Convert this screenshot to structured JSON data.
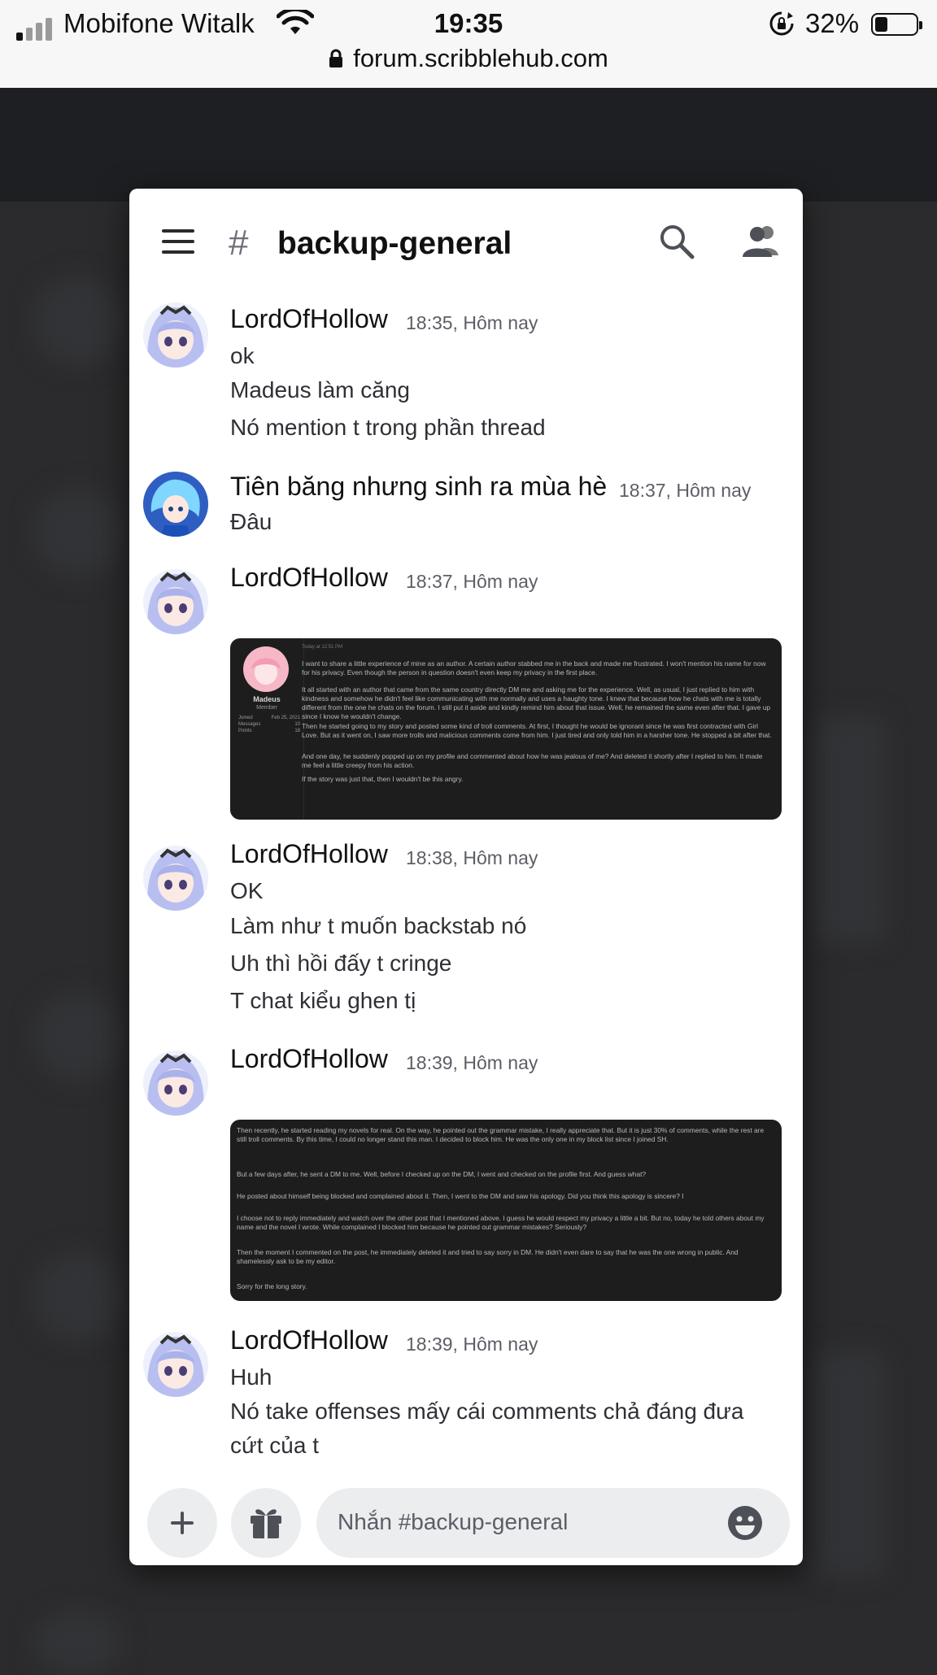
{
  "status_bar": {
    "carrier": "Mobifone Witalk",
    "time": "19:35",
    "battery_percent": "32%",
    "battery_level": 0.32,
    "url": "forum.scribblehub.com"
  },
  "channel": {
    "hash": "#",
    "name": "backup-general"
  },
  "messages": [
    {
      "author": "LordOfHollow",
      "timestamp": "18:35, Hôm nay",
      "lines": [
        "ok",
        "Madeus làm căng",
        "Nó mention t trong phần thread"
      ]
    },
    {
      "author": "Tiên băng nhưng sinh ra mùa hè",
      "timestamp": "18:37, Hôm nay",
      "lines": [
        "Đâu"
      ]
    },
    {
      "author": "LordOfHollow",
      "timestamp": "18:37, Hôm nay",
      "attachment": {
        "header": "Today at 12:51 PM",
        "profile_name": "Madeus",
        "profile_role": "Member",
        "profile_stats": [
          {
            "label": "Joined",
            "value": "Feb 25, 2021"
          },
          {
            "label": "Messages",
            "value": "10"
          },
          {
            "label": "Points",
            "value": "18"
          }
        ],
        "paragraphs": [
          "I want to share a little experience of mine as an author. A certain author stabbed me in the back and made me frustrated. I won't mention his name for now for his privacy. Even though the person in question doesn't even keep my privacy in the first place.",
          "It all started with an author that came from the same country directly DM me and asking me for the experience. Well, as usual, I just replied to him with kindness and somehow he didn't feel like communicating with me normally and uses a haughty tone. I knew that because how he chats with me is totally different from the one he chats on the forum. I still put it aside and kindly remind him about that issue. Well, he remained the same even after that. I gave up since I know he wouldn't change.",
          "Then he started going to my story and posted some kind of troll comments. At first, I thought he would be ignorant since he was first contracted with Girl Love. But as it went on, I saw more trolls and malicious comments come from him. I just tired and only told him in a harsher tone. He stopped a bit after that.",
          "And one day, he suddenly popped up on my profile and commented about how he was jealous of me? And deleted it shortly after I replied to him. It made me feel a little creepy from his action.",
          "If the story was just that, then I wouldn't be this angry."
        ]
      }
    },
    {
      "author": "LordOfHollow",
      "timestamp": "18:38, Hôm nay",
      "lines": [
        "OK",
        "Làm như t muốn backstab nó",
        "Uh thì hồi đấy t cringe",
        "T chat kiểu ghen tị"
      ]
    },
    {
      "author": "LordOfHollow",
      "timestamp": "18:39, Hôm nay",
      "attachment": {
        "paragraphs": [
          "Then recently, he started reading my novels for real. On the way, he pointed out the grammar mistake, I really appreciate that. But it is just 30% of comments, while the rest are still troll comments. By this time, I could no longer stand this man. I decided to block him. He was the only one in my block list since I joined SH.",
          "But a few days after, he sent a DM to me. Well, before I checked up on the DM, I went and checked on the profile first. And guess what?",
          "He posted about himself being blocked and complained about it. Then, I went to the DM and saw his apology. Did you think this apology is sincere? I",
          "I choose not to reply immediately and watch over the other post that I mentioned above. I guess he would respect my privacy a little a bit. But no, today he told others about my name and the novel I wrote. While complained I blocked him because he pointed out grammar mistakes? Seriously?",
          "Then the moment I commented on the post, he immediately deleted it and tried to say sorry in DM. He didn't even dare to say that he was the one wrong in public. And shamelessly ask to be my editor.",
          "Sorry for the long story."
        ]
      }
    },
    {
      "author": "LordOfHollow",
      "timestamp": "18:39, Hôm nay",
      "lines": [
        "Huh",
        "Nó take offenses mấy cái comments chả đáng đưa",
        "cứt của t"
      ]
    }
  ],
  "composer": {
    "placeholder": "Nhắn #backup-general"
  },
  "icons": {
    "menu": "hamburger-icon",
    "search": "search-icon",
    "members": "members-icon",
    "add": "plus-icon",
    "gift": "gift-icon",
    "emoji": "emoji-icon"
  },
  "colors": {
    "page_background": "#2b2b2d",
    "modal_background": "#ffffff",
    "text_primary": "#111111",
    "text_muted": "#5c5e66",
    "composer_fill": "#ebedef",
    "attachment_background": "#1d1d1e"
  }
}
